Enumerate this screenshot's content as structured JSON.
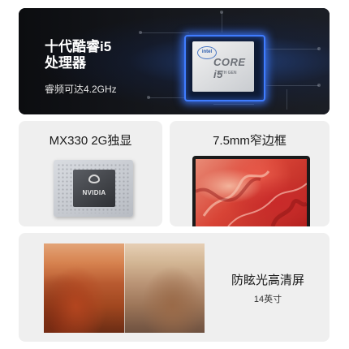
{
  "cpu": {
    "title_line1": "十代酷睿i5",
    "title_line2": "处理器",
    "subtitle": "睿频可达4.2GHz",
    "chip_brand": "intel",
    "chip_model": "CORE i5",
    "chip_gen": "10TH GEN",
    "glow_color": "#3f7cff"
  },
  "gpu": {
    "title": "MX330 2G独显",
    "chip_brand": "NVIDIA"
  },
  "bezel": {
    "title": "7.5mm窄边框"
  },
  "screen": {
    "title": "防眩光高清屏",
    "size": "14英寸"
  }
}
